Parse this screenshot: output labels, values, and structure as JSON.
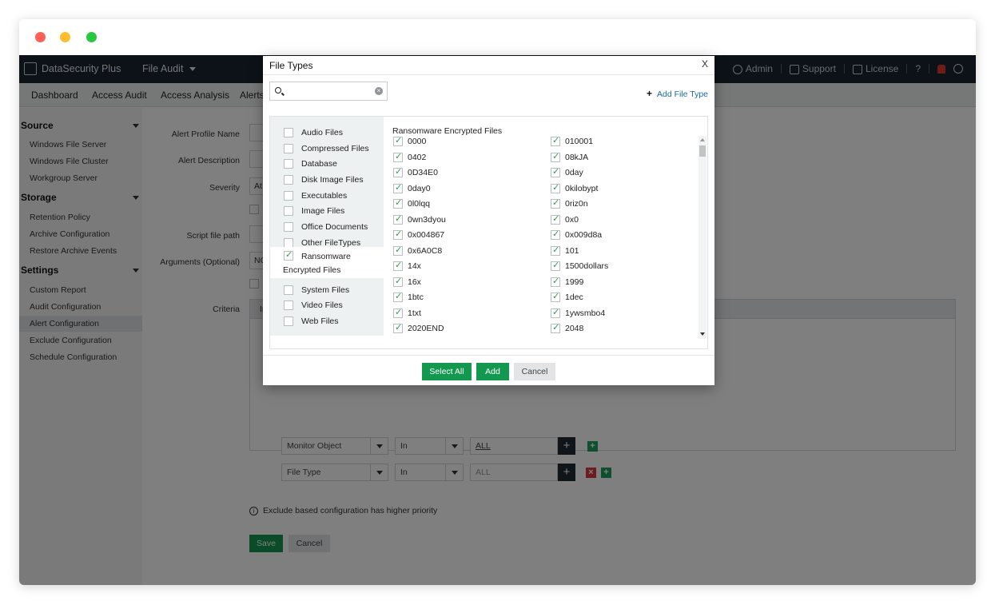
{
  "app": {
    "brand": "DataSecurity Plus",
    "module": "File Audit",
    "toplinks": {
      "admin": "Admin",
      "support": "Support",
      "license": "License",
      "help": "?"
    }
  },
  "nav": {
    "items": [
      "Dashboard",
      "Access Audit",
      "Access Analysis",
      "Alerts"
    ]
  },
  "sidebar": {
    "sections": [
      {
        "title": "Source",
        "items": [
          "Windows File Server",
          "Windows File Cluster",
          "Workgroup Server"
        ]
      },
      {
        "title": "Storage",
        "items": [
          "Retention Policy",
          "Archive Configuration",
          "Restore Archive Events"
        ]
      },
      {
        "title": "Settings",
        "items": [
          "Custom Report",
          "Audit Configuration",
          "Alert Configuration",
          "Exclude Configuration",
          "Schedule Configuration"
        ]
      }
    ],
    "active": "Alert Configuration"
  },
  "form": {
    "alert_profile_name_label": "Alert Profile Name",
    "alert_description_label": "Alert Description",
    "severity_label": "Severity",
    "severity_value": "At",
    "script_path_label": "Script file path",
    "arguments_label": "Arguments (Optional)",
    "arguments_value": "NC",
    "criteria_label": "Criteria",
    "criteria_head_value": "In",
    "rows": [
      {
        "field": "Monitor Object",
        "op": "In",
        "value": "ALL"
      },
      {
        "field": "File Type",
        "op": "In",
        "value": "ALL"
      }
    ],
    "add_symbol": "+",
    "remove_symbol": "×",
    "info_glyph": "i",
    "info_note": "Exclude based configuration has higher priority",
    "save": "Save",
    "cancel": "Cancel"
  },
  "modal": {
    "title": "File Types",
    "close": "X",
    "search_placeholder": "",
    "clear_glyph": "×",
    "add_file_type": "Add File Type",
    "add_symbol": "+",
    "categories": [
      {
        "label": "Audio Files",
        "checked": false
      },
      {
        "label": "Compressed Files",
        "checked": false
      },
      {
        "label": "Database",
        "checked": false
      },
      {
        "label": "Disk Image Files",
        "checked": false
      },
      {
        "label": "Executables",
        "checked": false
      },
      {
        "label": "Image Files",
        "checked": false
      },
      {
        "label": "Office Documents",
        "checked": false
      },
      {
        "label": "Other FileTypes",
        "checked": false
      },
      {
        "label": "Ransomware",
        "label2": "Encrypted Files",
        "checked": true
      },
      {
        "label": "System Files",
        "checked": false
      },
      {
        "label": "Video Files",
        "checked": false
      },
      {
        "label": "Web Files",
        "checked": false
      }
    ],
    "selected_category_title": "Ransomware Encrypted Files",
    "types_left": [
      "0000",
      "0402",
      "0D34E0",
      "0day0",
      "0l0lqq",
      "0wn3dyou",
      "0x004867",
      "0x6A0C8",
      "14x",
      "16x",
      "1btc",
      "1txt",
      "2020END"
    ],
    "types_right": [
      "010001",
      "08kJA",
      "0day",
      "0kilobypt",
      "0riz0n",
      "0x0",
      "0x009d8a",
      "101",
      "1500dollars",
      "1999",
      "1dec",
      "1ywsmbo4",
      "2048"
    ],
    "buttons": {
      "select_all": "Select All",
      "add": "Add",
      "cancel": "Cancel"
    }
  },
  "colors": {
    "primary": "#12984f",
    "topbar": "#1a2530",
    "link": "#1a6ba0"
  }
}
